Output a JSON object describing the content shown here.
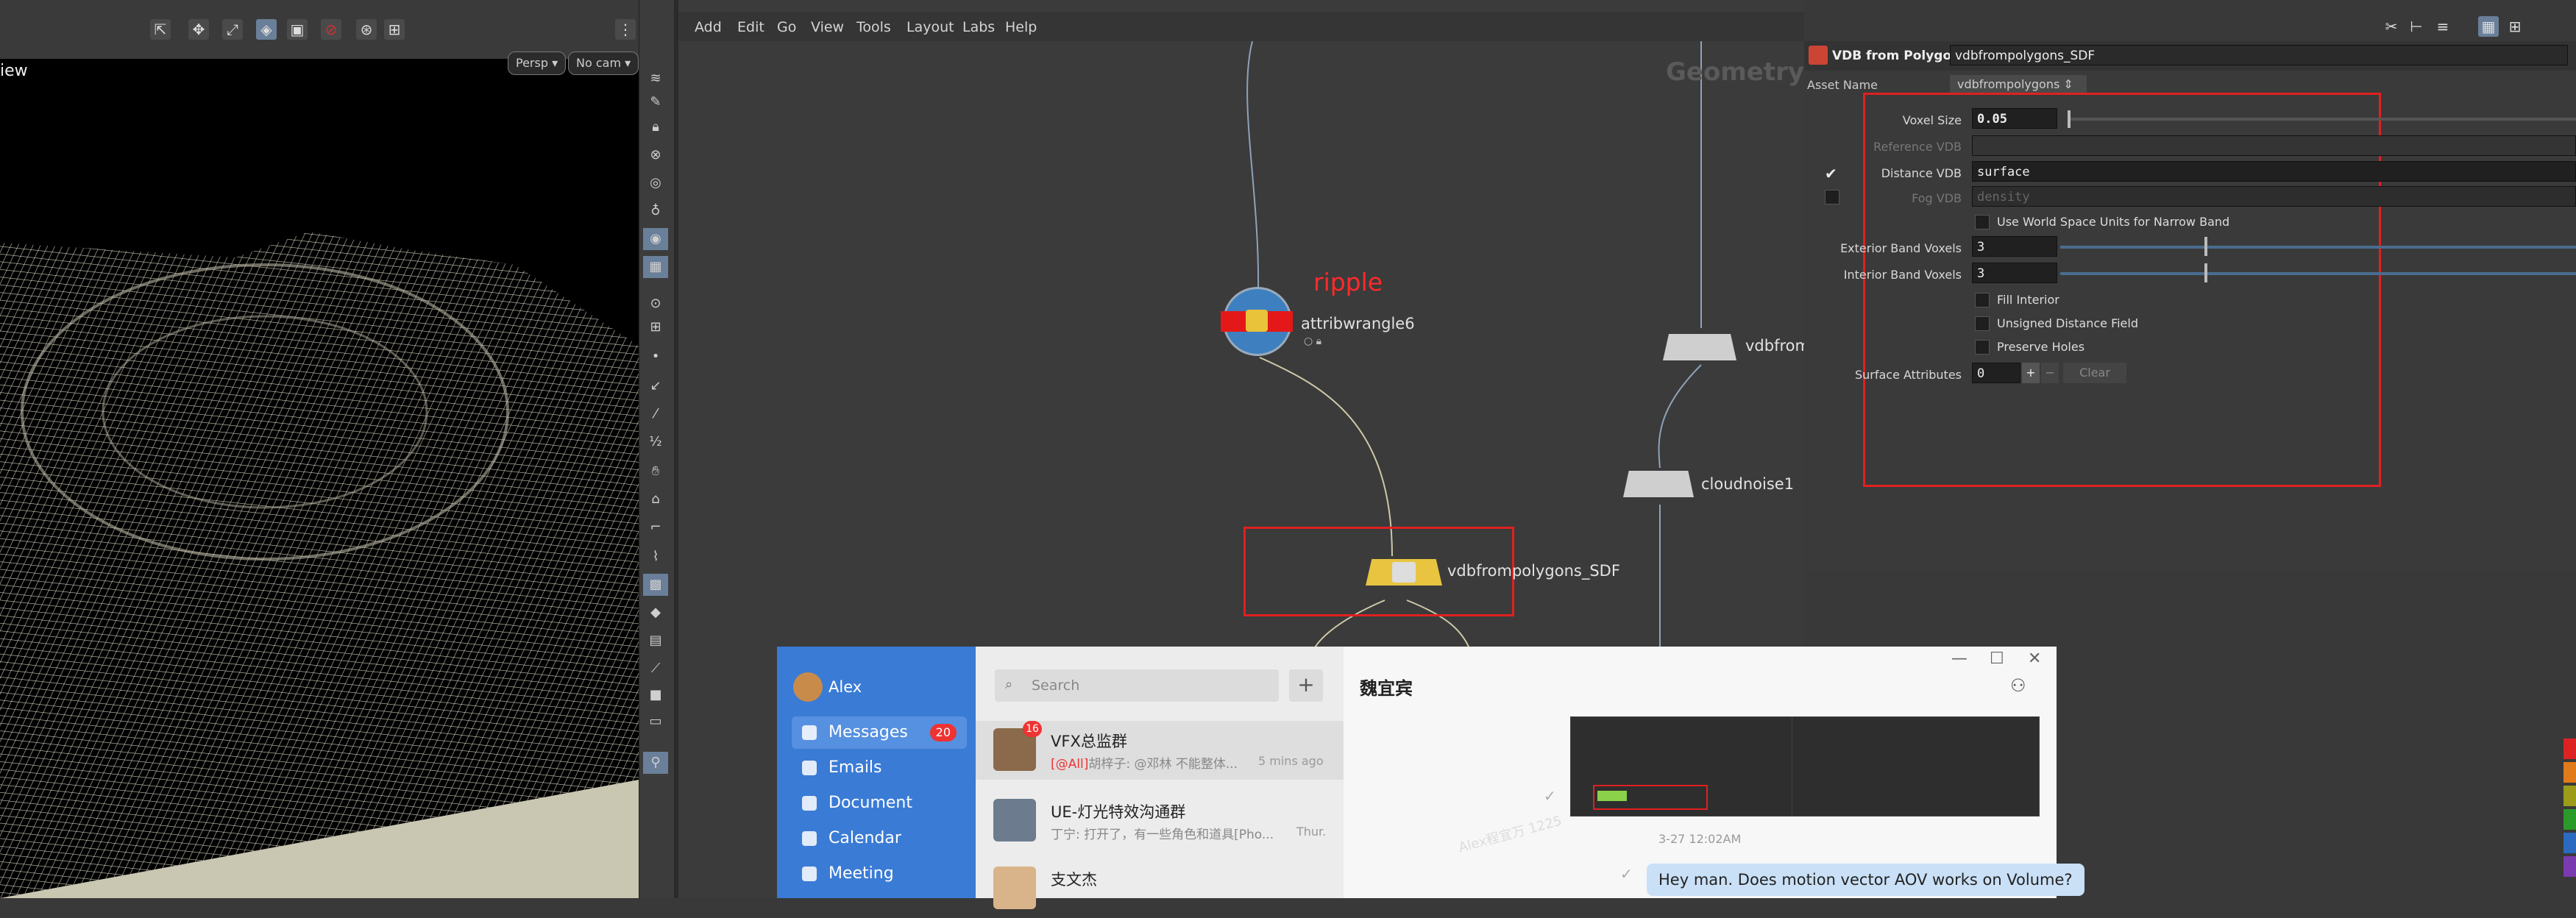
{
  "viewport": {
    "title": "iew",
    "camera_view_dd": "Persp",
    "camera_dd": "No cam"
  },
  "network": {
    "menu": [
      "Add",
      "Edit",
      "Go",
      "View",
      "Tools",
      "Layout",
      "Labs",
      "Help"
    ],
    "context_label": "Geometry",
    "nodes": {
      "wrangle_annotation": "ripple",
      "wrangle": "attribwrangle6",
      "vdb_sdf": "vdbfrompolygons_SDF",
      "vdb_right": "vdbfrom",
      "noise": "cloudnoise1"
    }
  },
  "params": {
    "node_type": "VDB from Polygons",
    "node_name": "vdbfrompolygons_SDF",
    "asset_name_label": "Asset Name",
    "asset_name_value": "vdbfrompolygons",
    "voxel_size_label": "Voxel Size",
    "voxel_size_value": "0.05",
    "reference_vdb_label": "Reference VDB",
    "distance_vdb_label": "Distance VDB",
    "distance_vdb_value": "surface",
    "fog_vdb_label": "Fog VDB",
    "fog_vdb_value": "density",
    "world_space_label": "Use World Space Units for Narrow Band",
    "exterior_label": "Exterior Band Voxels",
    "exterior_value": "3",
    "interior_label": "Interior Band Voxels",
    "interior_value": "3",
    "fill_interior_label": "Fill Interior",
    "unsigned_label": "Unsigned Distance Field",
    "preserve_label": "Preserve Holes",
    "surface_attrs_label": "Surface Attributes",
    "surface_attrs_value": "0",
    "clear_label": "Clear"
  },
  "chat": {
    "user": "Alex",
    "nav": [
      {
        "label": "Messages",
        "badge": "20"
      },
      {
        "label": "Emails"
      },
      {
        "label": "Document"
      },
      {
        "label": "Calendar"
      },
      {
        "label": "Meeting"
      }
    ],
    "search_placeholder": "Search",
    "conversations": [
      {
        "name": "VFX总监群",
        "badge": "16",
        "preview_tag": "[@All]",
        "preview": "胡梓子: @邓林  不能整体...",
        "time": "5 mins ago"
      },
      {
        "name": "UE-灯光特效沟通群",
        "preview": "丁宁: 打开了，有一些角色和道具[Pho...",
        "time": "Thur."
      },
      {
        "name": "支文杰",
        "preview": "",
        "time": ""
      }
    ],
    "contact_name": "魏宜宾",
    "timestamp": "3-27 12:02AM",
    "message": "Hey man. Does motion vector AOV works on Volume?",
    "watermark": "Alex程宜万 1225"
  }
}
